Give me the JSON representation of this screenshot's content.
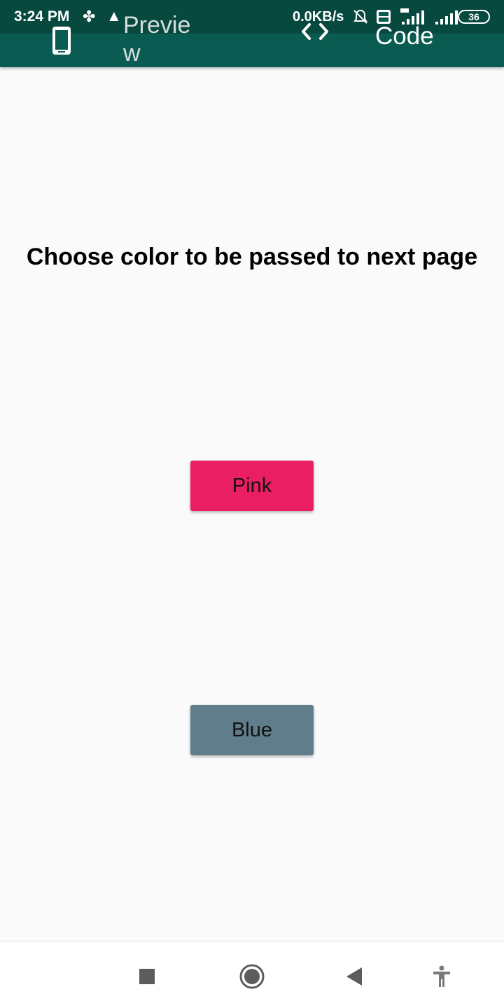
{
  "status_bar": {
    "time": "3:24 PM",
    "net_speed": "0.0KB/s",
    "battery": "36",
    "icons": [
      "fan-icon",
      "warning-icon",
      "bell-off-icon",
      "volte-icon",
      "signal-4g-icon",
      "signal-icon",
      "battery-icon"
    ]
  },
  "app_bar": {
    "tabs": [
      {
        "label": "Preview",
        "icon": "phone-icon"
      },
      {
        "label": "Code",
        "icon": "code-icon"
      }
    ],
    "color": "#0a5c52"
  },
  "main": {
    "heading": "Choose color to be passed to next page",
    "buttons": [
      {
        "label": "Pink",
        "color": "#e91e63"
      },
      {
        "label": "Blue",
        "color": "#607d8b"
      }
    ]
  },
  "nav_bar": {
    "icons": [
      "recents-icon",
      "home-icon",
      "back-icon",
      "accessibility-icon"
    ]
  }
}
